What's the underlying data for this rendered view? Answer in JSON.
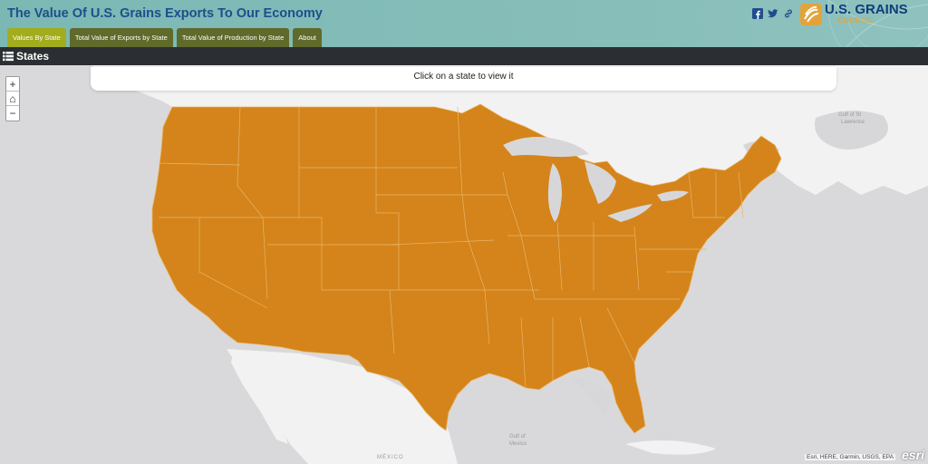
{
  "header": {
    "title": "The Value Of U.S. Grains Exports To Our Economy",
    "logo_main": "U.S. GRAINS",
    "logo_sub": "COUNCIL",
    "tabs": [
      {
        "label": "Values By State",
        "active": true
      },
      {
        "label": "Total Value of Exports by State",
        "active": false
      },
      {
        "label": "Total Value of Production by State",
        "active": false
      },
      {
        "label": "About",
        "active": false
      }
    ],
    "social_icons": [
      "facebook-icon",
      "twitter-icon",
      "link-icon"
    ]
  },
  "toolbar": {
    "label": "States"
  },
  "map": {
    "prompt": "Click on a state to view it",
    "zoom_in": "+",
    "home": "⌂",
    "zoom_out": "−",
    "labels": {
      "mexico": "MÉXICO",
      "gulf_mexico_1": "Gulf of",
      "gulf_mexico_2": "Mexico",
      "gulf_st_lawrence_1": "Gulf of St",
      "gulf_st_lawrence_2": "Lawrence"
    },
    "attribution": "Esri, HERE, Garmin, USGS, EPA",
    "esri_logo": "esri",
    "state_fill": "#d4841a",
    "state_border": "#e9b56a",
    "land_color": "#f2f2f2",
    "water_color": "#d7d7d9"
  }
}
